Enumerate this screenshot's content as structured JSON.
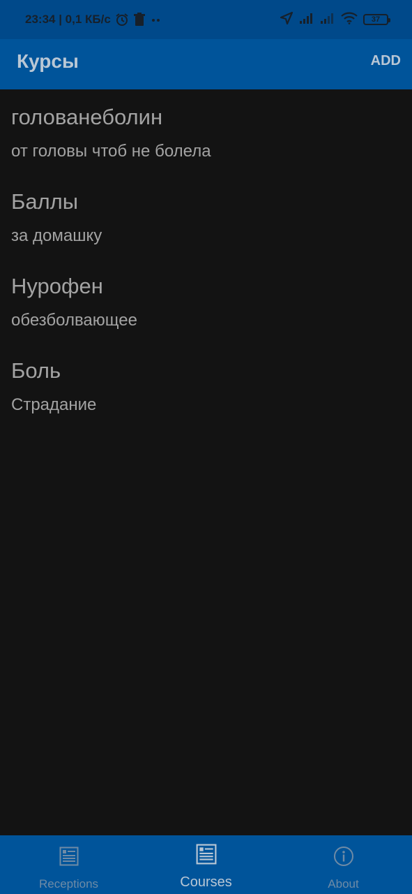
{
  "status_bar": {
    "time_network": "23:34 | 0,1 КБ/с",
    "battery": "37"
  },
  "app_bar": {
    "title": "Курсы",
    "add_label": "ADD"
  },
  "courses": [
    {
      "name": "голованеболин",
      "description": "от головы чтоб не болела"
    },
    {
      "name": "Баллы",
      "description": "за домашку"
    },
    {
      "name": "Нурофен",
      "description": "обезболвающее"
    },
    {
      "name": "Боль",
      "description": "Страдание"
    }
  ],
  "bottom_nav": {
    "tabs": [
      {
        "label": "Receptions",
        "icon": "list-document-icon"
      },
      {
        "label": "Courses",
        "icon": "list-document-icon"
      },
      {
        "label": "About",
        "icon": "info-icon"
      }
    ],
    "active_tab": "Courses"
  },
  "colors": {
    "app_bar": "#00549a",
    "status_bar": "#00498a",
    "background": "#131313",
    "text": "#a3a3a3",
    "active_tab": "#b9c7d5",
    "inactive_tab": "#6f8ba6"
  }
}
